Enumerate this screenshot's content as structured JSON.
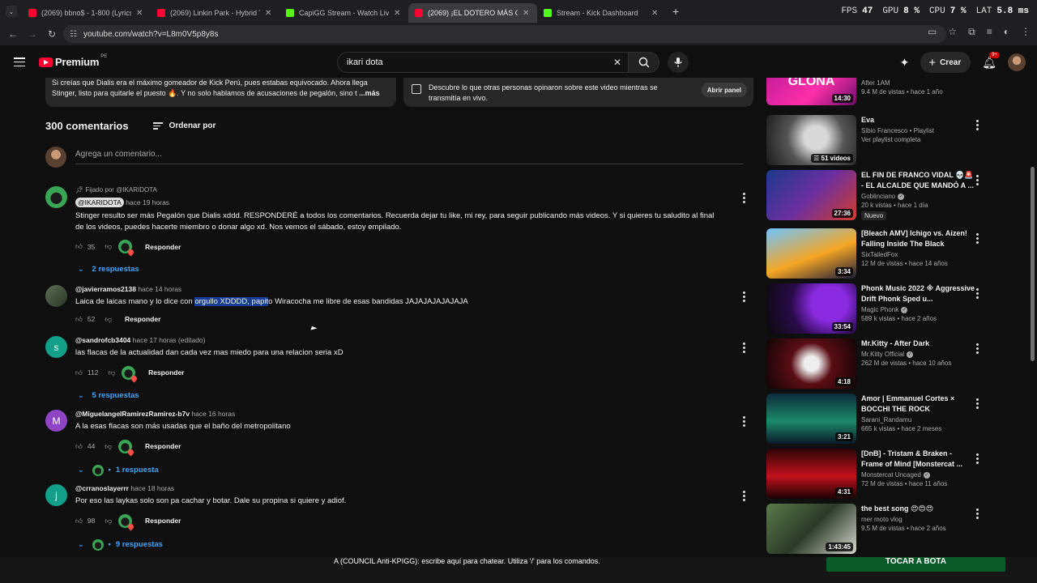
{
  "browser": {
    "tabs": [
      {
        "title": "(2069) bbno$ - 1-800 (Lyrics) ft.",
        "icon": "youtube-icon",
        "active": false
      },
      {
        "title": "(2069) Linkin Park - Hybrid The",
        "icon": "youtube-icon",
        "active": false
      },
      {
        "title": "CapiGG Stream - Watch Live on",
        "icon": "kick-icon",
        "active": false
      },
      {
        "title": "(2069) ¡EL DOTERO MÁS CACH",
        "icon": "youtube-icon",
        "active": true
      },
      {
        "title": "Stream - Kick Dashboard",
        "icon": "kick-icon",
        "active": false
      }
    ],
    "url": "youtube.com/watch?v=L8m0V5p8y8s"
  },
  "overlay": {
    "fps_label": "FPS",
    "fps_value": "47",
    "gpu_label": "GPU",
    "gpu_value": "8 %",
    "cpu_label": "CPU",
    "cpu_value": "7 %",
    "lat_label": "LAT",
    "lat_value": "5.8 ms"
  },
  "masthead": {
    "brand": "Premium",
    "country": "PE",
    "search_value": "ikari dota",
    "create_label": "Crear",
    "notifications": "9+"
  },
  "description": {
    "text": "Si creías que Dialis era el máximo gomeador de Kick Perú, pues estabas equivocado. Ahora llega Stinger, listo para quitarle el puesto 🔥. Y no solo hablamos de acusaciones de pegalón, sino t",
    "more": "...más"
  },
  "chat_panel": {
    "text": "Descubre lo que otras personas opinaron sobre este video mientras se transmitía en vivo.",
    "button": "Abrir panel"
  },
  "comments_header": {
    "count": "300 comentarios",
    "sort": "Ordenar por",
    "add_placeholder": "Agrega un comentario..."
  },
  "comments": [
    {
      "pinned": "Fijado por @IKARIDOTA",
      "author": "@IKARIDOTA",
      "time": "hace 19 horas",
      "text": "Stinger resulto ser más Pegalón que Dialis xddd. RESPONDERÉ a todos los comentarios. Recuerda dejar tu like, mi rey, para seguir publicando más videos. Y si quieres tu saludito al final de los videos, puedes hacerte miembro o donar algo xd. Nos vemos el sábado, estoy empilado.",
      "likes": "35",
      "reply": "Responder",
      "replies": "2 respuestas"
    },
    {
      "author": "@javierramos2138",
      "time": "hace 14 horas",
      "text_before": "Laica de laicas mano y lo dice con ",
      "text_highlight": "orgullo XDDDD, papit",
      "text_after": "o Wiracocha me libre de esas bandidas JAJAJAJAJAJAJA",
      "likes": "52",
      "reply": "Responder"
    },
    {
      "author": "@sandrofcb3404",
      "time": "hace 17 horas (editado)",
      "avatar_letter": "s",
      "text": "las flacas de la actualidad dan cada vez mas miedo para una relacion seria xD",
      "likes": "112",
      "reply": "Responder",
      "replies": "5 respuestas"
    },
    {
      "author": "@MiguelangelRamirezRamirez-b7v",
      "time": "hace 16 horas",
      "avatar_letter": "M",
      "text": "A la esas flacas son más usadas que el baño del metropolitano",
      "likes": "44",
      "reply": "Responder",
      "replies": "1 respuesta"
    },
    {
      "author": "@crranoslayerrr",
      "time": "hace 18 horas",
      "avatar_letter": "j",
      "text": "Por eso las laykas solo son pa cachar y botar. Dale su propina si quiere y adiof.",
      "likes": "98",
      "reply": "Responder",
      "replies": "9 respuestas"
    }
  ],
  "recommendations": [
    {
      "title": "GLONA",
      "channel": "After 1AM",
      "meta": "9.4 M de vistas • hace 1 año",
      "duration": "14:30"
    },
    {
      "title": "Eva",
      "channel": "Sibio Francesco • Playlist",
      "meta": "Ver playlist completa",
      "duration": "51 videos"
    },
    {
      "title": "EL FIN DE FRANCO VIDAL 💀🚨 - EL ALCALDE QUE MANDÓ A ...",
      "channel": "Goblinciano",
      "meta": "20 k vistas • hace 1 día",
      "duration": "27:36",
      "badge": "Nuevo"
    },
    {
      "title": "[Bleach AMV] Ichigo vs. Aizen! Falling Inside The Black",
      "channel": "SixTailedFox",
      "meta": "12 M de vistas • hace 14 años",
      "duration": "3:34"
    },
    {
      "title": "Phonk Music 2022 ※ Aggressive Drift Phonk Sped u...",
      "channel": "Magic Phonk",
      "meta": "589 k vistas • hace 2 años",
      "duration": "33:54"
    },
    {
      "title": "Mr.Kitty - After Dark",
      "channel": "Mr.Kitty Official",
      "meta": "262 M de vistas • hace 10 años",
      "duration": "4:18"
    },
    {
      "title": "Amor | Emmanuel Cortes × BOCCHI THE ROCK",
      "channel": "Sarani_Randamu",
      "meta": "665 k vistas • hace 2 meses",
      "duration": "3:21"
    },
    {
      "title": "[DnB] - Tristam & Braken - Frame of Mind [Monstercat ...",
      "channel": "Monstercat Uncaged",
      "meta": "72 M de vistas • hace 11 años",
      "duration": "4:31"
    },
    {
      "title": "the best song 😍😍😍",
      "channel": "mer moto vlog",
      "meta": "9.5 M de vistas • hace 2 años",
      "duration": "1:43:45"
    }
  ],
  "bottom_bar": {
    "chat_text": "A (COUNCIL Anti-KPIGG): escribe aquí para chatear. Utiliza '/' para los comandos.",
    "follow": "TOCAR A BOTA"
  }
}
